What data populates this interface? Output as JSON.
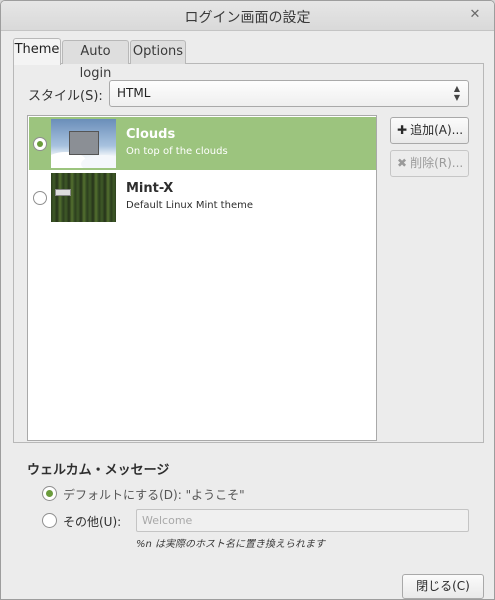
{
  "window": {
    "title": "ログイン画面の設定",
    "close_icon": "✕"
  },
  "tabs": [
    {
      "label": "Theme",
      "active": true
    },
    {
      "label": "Auto login",
      "active": false
    },
    {
      "label": "Options",
      "active": false
    }
  ],
  "style": {
    "label": "スタイル(S):",
    "value": "HTML"
  },
  "themes": [
    {
      "name": "Clouds",
      "description": "On top of the clouds",
      "selected": true
    },
    {
      "name": "Mint-X",
      "description": "Default Linux Mint theme",
      "selected": false
    }
  ],
  "buttons": {
    "add": {
      "label": "追加(A)...",
      "icon": "plus-icon",
      "enabled": true
    },
    "remove": {
      "label": "削除(R)...",
      "icon": "x-icon",
      "enabled": false
    },
    "close": {
      "label": "閉じる(C)"
    }
  },
  "welcome": {
    "title": "ウェルカム・メッセージ",
    "default_option": "デフォルトにする(D): \"ようこそ\"",
    "other_option": "その他(U):",
    "input_placeholder": "Welcome",
    "hint": "%n は実際のホスト名に置き換えられます",
    "selected": "default"
  },
  "colors": {
    "selection": "#9cc47e",
    "accent": "#6b9c3c"
  }
}
